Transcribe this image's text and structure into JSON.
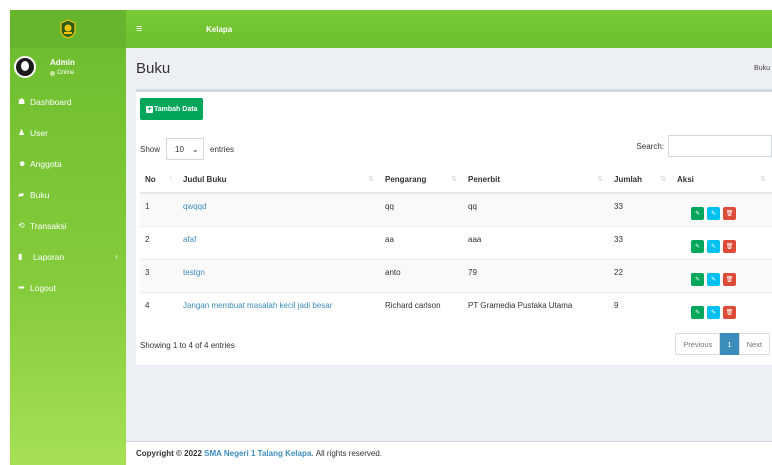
{
  "header": {
    "title": "Kelapa",
    "menu_icon": "≡"
  },
  "user": {
    "name": "Admin",
    "status": "Online"
  },
  "sidebar": {
    "items": [
      {
        "icon": "dashboard-icon",
        "glyph": "☗",
        "label": "Dashboard"
      },
      {
        "icon": "user-icon",
        "glyph": "♟",
        "label": "User"
      },
      {
        "icon": "users-icon",
        "glyph": "☻",
        "label": "Anggota"
      },
      {
        "icon": "book-icon",
        "glyph": "▰",
        "label": "Buku"
      },
      {
        "icon": "transaction-icon",
        "glyph": "⟲",
        "label": "Transaksi"
      },
      {
        "icon": "file-icon",
        "glyph": "▮",
        "label": "Laporan",
        "chevron": "‹"
      },
      {
        "icon": "logout-icon",
        "glyph": "➦",
        "label": "Logout"
      }
    ]
  },
  "page": {
    "title": "Buku",
    "breadcrumb": "Buku"
  },
  "toolbar": {
    "add_label": "Tambah Data"
  },
  "table_controls": {
    "show": "Show",
    "page_length": "10",
    "entries": "entries",
    "search": "Search:"
  },
  "table": {
    "headers": [
      "No",
      "Judul Buku",
      "Pengarang",
      "Penerbit",
      "Jumlah",
      "Aksi"
    ],
    "rows": [
      {
        "no": "1",
        "judul": "qwqqd",
        "pengarang": "qq",
        "penerbit": "qq",
        "jumlah": "33"
      },
      {
        "no": "2",
        "judul": "afaf",
        "pengarang": "aa",
        "penerbit": "aaa",
        "jumlah": "33"
      },
      {
        "no": "3",
        "judul": "testgn",
        "pengarang": "anto",
        "penerbit": "79",
        "jumlah": "22"
      },
      {
        "no": "4",
        "judul": "Jangan membuat masalah kecil jadi besar",
        "pengarang": "Richard carlson",
        "penerbit": "PT Gramedia Pustaka Utama",
        "jumlah": "9"
      }
    ]
  },
  "pagination": {
    "info": "Showing 1 to 4 of 4 entries",
    "previous": "Previous",
    "current": "1",
    "next": "Next"
  },
  "footer": {
    "prefix": "Copyright © 2022",
    "school": "SMA Negeri 1 Talang Kelapa.",
    "suffix": "All rights reserved."
  },
  "colors": {
    "accent": "#6dbf2f",
    "success": "#00a65a",
    "info": "#00c0ef",
    "danger": "#dd4b39",
    "link": "#3c8dbc"
  }
}
